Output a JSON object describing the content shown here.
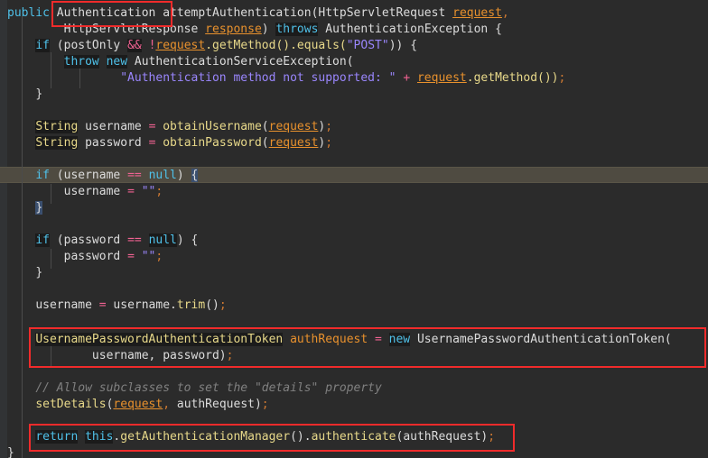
{
  "editor": {
    "language": "java",
    "theme": "darcula",
    "background": "#2b2b2b",
    "gutter_background": "#313335",
    "caret_line_background": "#4f4b41",
    "annotation_color": "#f02b2b",
    "font_size_px": 13,
    "line_height_px": 18
  },
  "code": {
    "lines": [
      {
        "n": 1,
        "text": "public Authentication attemptAuthentication(HttpServletRequest request,"
      },
      {
        "n": 2,
        "text": "        HttpServletResponse response) throws AuthenticationException {"
      },
      {
        "n": 3,
        "text": "    if (postOnly && !request.getMethod().equals(\"POST\")) {"
      },
      {
        "n": 4,
        "text": "        throw new AuthenticationServiceException("
      },
      {
        "n": 5,
        "text": "                \"Authentication method not supported: \" + request.getMethod());"
      },
      {
        "n": 6,
        "text": "    }"
      },
      {
        "n": 7,
        "text": ""
      },
      {
        "n": 8,
        "text": "    String username = obtainUsername(request);"
      },
      {
        "n": 9,
        "text": "    String password = obtainPassword(request);"
      },
      {
        "n": 10,
        "text": ""
      },
      {
        "n": 11,
        "text": "    if (username == null) {"
      },
      {
        "n": 12,
        "text": "        username = \"\";"
      },
      {
        "n": 13,
        "text": "    }"
      },
      {
        "n": 14,
        "text": ""
      },
      {
        "n": 15,
        "text": "    if (password == null) {"
      },
      {
        "n": 16,
        "text": "        password = \"\";"
      },
      {
        "n": 17,
        "text": "    }"
      },
      {
        "n": 18,
        "text": ""
      },
      {
        "n": 19,
        "text": "    username = username.trim();"
      },
      {
        "n": 20,
        "text": ""
      },
      {
        "n": 21,
        "text": "    UsernamePasswordAuthenticationToken authRequest = new UsernamePasswordAuthenticationToken("
      },
      {
        "n": 22,
        "text": "            username, password);"
      },
      {
        "n": 23,
        "text": ""
      },
      {
        "n": 24,
        "text": "    // Allow subclasses to set the \"details\" property"
      },
      {
        "n": 25,
        "text": "    setDetails(request, authRequest);"
      },
      {
        "n": 26,
        "text": ""
      },
      {
        "n": 27,
        "text": "    return this.getAuthenticationManager().authenticate(authRequest);"
      },
      {
        "n": 28,
        "text": "}"
      }
    ]
  },
  "tokens": {
    "l1": {
      "public": "public",
      "authentication": "Authentication",
      "method": "attemptAuthentication",
      "paren_open": "(",
      "http_servlet_request": "HttpServletRequest",
      "request": "request",
      "comma": ","
    },
    "l2": {
      "http_servlet_response": "HttpServletResponse",
      "response": "response",
      "paren_close": ")",
      "throws": "throws",
      "auth_exception": "AuthenticationException",
      "brace": "{"
    },
    "l3": {
      "if": "if",
      "open": "(",
      "post_only": "postOnly",
      "and": "&&",
      "bang": "!",
      "request": "request",
      "dot_get_method": ".getMethod().equals(",
      "post_str": "\"POST\"",
      "close": "))",
      "brace": "{"
    },
    "l4": {
      "throw": "throw",
      "new": "new",
      "cls": "AuthenticationServiceException",
      "open": "("
    },
    "l5": {
      "msg": "\"Authentication method not supported: \"",
      "plus": "+",
      "request": "request",
      "tail": ".getMethod())",
      "semi": ";"
    },
    "l6": {
      "brace": "}"
    },
    "l8": {
      "string": "String",
      "name": "username",
      "eq": "=",
      "call": "obtainUsername",
      "open": "(",
      "request": "request",
      "close": ")",
      "semi": ";"
    },
    "l9": {
      "string": "String",
      "name": "password",
      "eq": "=",
      "call": "obtainPassword",
      "open": "(",
      "request": "request",
      "close": ")",
      "semi": ";"
    },
    "l11": {
      "if": "if",
      "open": "(",
      "name": "username",
      "eqeq": "==",
      "null": "null",
      "close": ")",
      "brace": "{"
    },
    "l12": {
      "name": "username",
      "eq": "=",
      "empty": "\"\"",
      "semi": ";"
    },
    "l13": {
      "brace": "}"
    },
    "l15": {
      "if": "if",
      "open": "(",
      "name": "password",
      "eqeq": "==",
      "null": "null",
      "close": ")",
      "brace": "{"
    },
    "l16": {
      "name": "password",
      "eq": "=",
      "empty": "\"\"",
      "semi": ";"
    },
    "l17": {
      "brace": "}"
    },
    "l19": {
      "name": "username",
      "eq": "=",
      "obj": "username.",
      "trim": "trim",
      "parens": "()",
      "semi": ";"
    },
    "l21": {
      "type": "UsernamePasswordAuthenticationToken",
      "var": "authRequest",
      "eq": "=",
      "new": "new",
      "ctor": "UsernamePasswordAuthenticationToken",
      "open": "("
    },
    "l22": {
      "args": "username, password)",
      "semi": ";"
    },
    "l24": {
      "comment": "// Allow subclasses to set the \"details\" property"
    },
    "l25": {
      "call": "setDetails",
      "open": "(",
      "request": "request",
      "comma": ", ",
      "arg": "authRequest",
      "close": ")",
      "semi": ";"
    },
    "l27": {
      "return": "return",
      "this": "this",
      "dot": ".",
      "get_mgr": "getAuthenticationManager",
      "parens": "().",
      "authenticate": "authenticate",
      "open": "(",
      "arg": "authRequest",
      "close": ")",
      "semi": ";"
    },
    "l28": {
      "brace": "}"
    }
  },
  "annotations": {
    "boxes": [
      {
        "id": "box-authentication-return-type",
        "label": "Authentication",
        "note": "highlights the Authentication return type in the method signature"
      },
      {
        "id": "box-auth-request-creation",
        "label": "UsernamePasswordAuthenticationToken authRequest = new UsernamePasswordAuthenticationToken(username, password);",
        "note": "highlights creation of the authentication token"
      },
      {
        "id": "box-return-authenticate",
        "label": "return this.getAuthenticationManager().authenticate(authRequest);",
        "note": "highlights the delegation to the AuthenticationManager"
      }
    ]
  }
}
